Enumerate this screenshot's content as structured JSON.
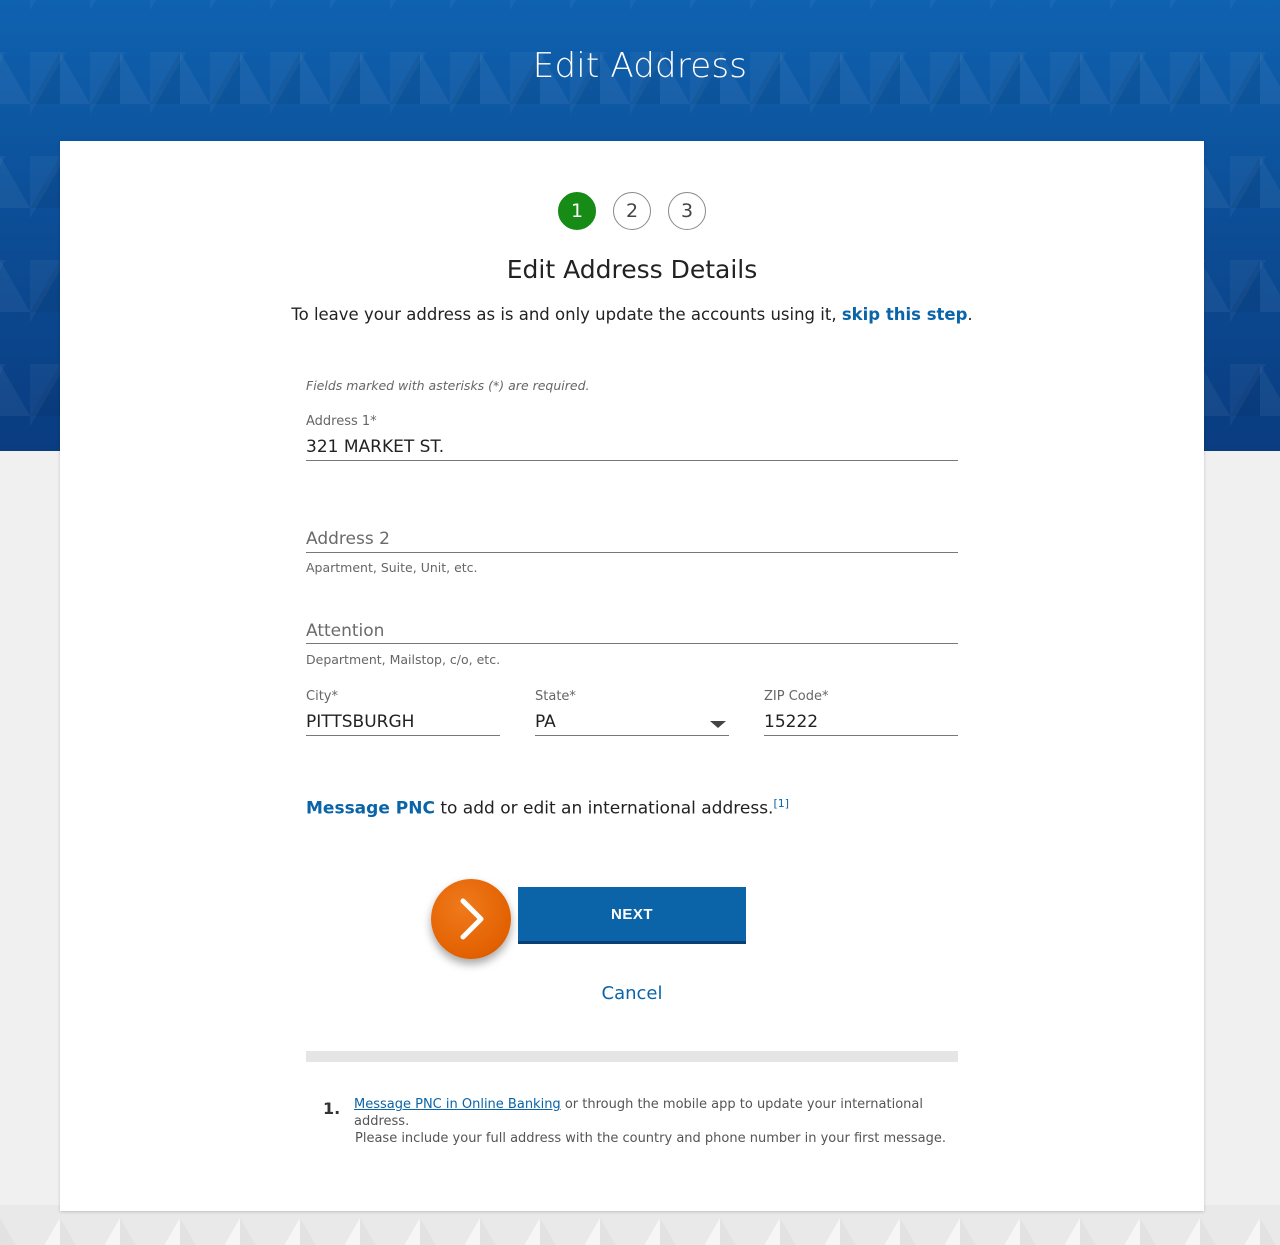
{
  "header": {
    "title": "Edit Address"
  },
  "steps": [
    "1",
    "2",
    "3"
  ],
  "active_step": 1,
  "section": {
    "title": "Edit Address Details",
    "intro_text": "To leave your address as is and only update the accounts using it,",
    "skip_link": "skip this step",
    "intro_end": "."
  },
  "form": {
    "required_note": "Fields marked with asterisks (*) are required.",
    "address1": {
      "label": "Address 1*",
      "value": "321 MARKET ST."
    },
    "address2": {
      "placeholder": "Address 2",
      "hint": "Apartment, Suite, Unit, etc."
    },
    "attention": {
      "placeholder": "Attention",
      "hint": "Department, Mailstop, c/o, etc."
    },
    "city": {
      "label": "City*",
      "value": "PITTSBURGH"
    },
    "state": {
      "label": "State*",
      "value": "PA"
    },
    "zip": {
      "label": "ZIP Code*",
      "value": "15222"
    }
  },
  "international": {
    "link": "Message PNC",
    "text": " to add or edit an international address.",
    "footnote_ref": "[1]"
  },
  "actions": {
    "next_label": "NEXT",
    "cancel_label": "Cancel"
  },
  "footnote": {
    "number": "1.",
    "link": "Message PNC in Online Banking",
    "line1_rest": " or through the mobile app to update your international address.",
    "line2": "Please include your full address with the country and phone number in your first message."
  },
  "colors": {
    "accent_blue": "#0a64a8",
    "active_step_green": "#168b16",
    "orange_indicator": "#e26100"
  },
  "icons": {
    "next_indicator": "chevron-right-icon",
    "state_dropdown": "caret-down-icon"
  }
}
